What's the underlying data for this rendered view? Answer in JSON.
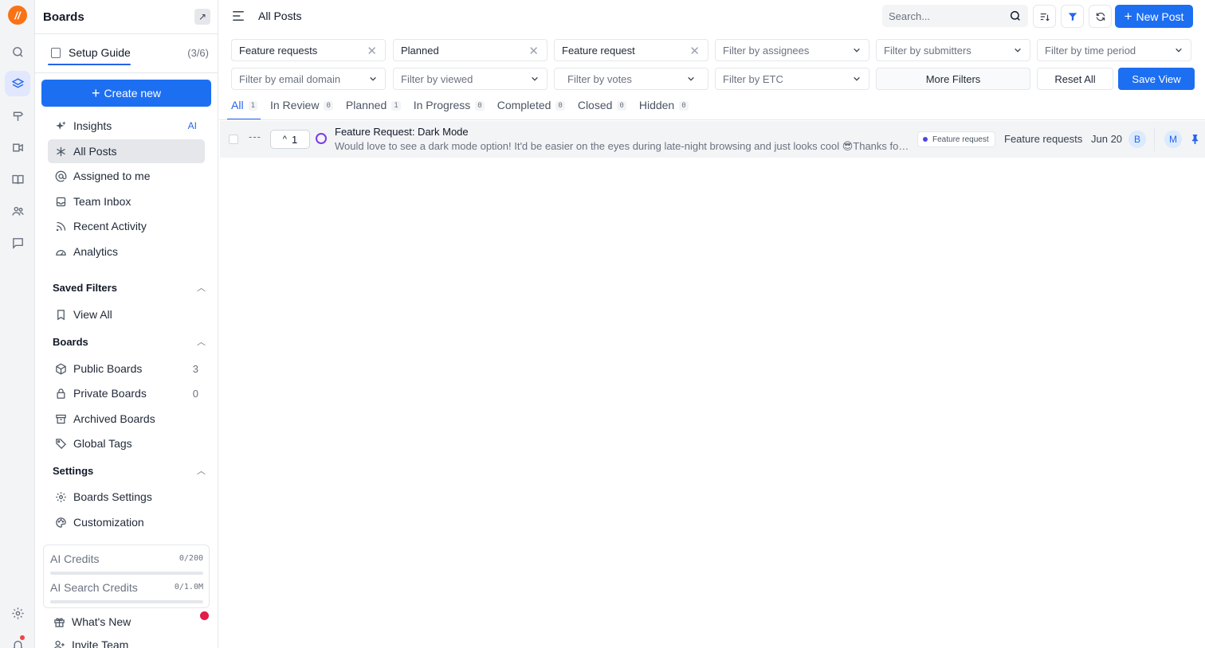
{
  "rail": {
    "logo": "//",
    "icons": [
      "search-icon",
      "layers-icon",
      "roadmap-icon",
      "changelog-icon",
      "book-icon",
      "users-icon",
      "chat-icon",
      "gear-icon",
      "bell-icon"
    ]
  },
  "sidebar": {
    "title": "Boards",
    "setup_label": "Setup Guide",
    "setup_count": "(3/6)",
    "create_label": "Create new",
    "nav": [
      {
        "label": "Insights",
        "badge": "AI"
      },
      {
        "label": "All Posts"
      },
      {
        "label": "Assigned to me"
      },
      {
        "label": "Team Inbox"
      },
      {
        "label": "Recent Activity"
      },
      {
        "label": "Analytics"
      }
    ],
    "saved_filters": {
      "title": "Saved Filters",
      "items": [
        {
          "label": "View All"
        }
      ]
    },
    "boards": {
      "title": "Boards",
      "items": [
        {
          "label": "Public Boards",
          "count": "3"
        },
        {
          "label": "Private Boards",
          "count": "0"
        },
        {
          "label": "Archived Boards"
        },
        {
          "label": "Global Tags"
        }
      ]
    },
    "settings": {
      "title": "Settings",
      "items": [
        {
          "label": "Boards Settings"
        },
        {
          "label": "Customization"
        }
      ]
    },
    "credits": [
      {
        "label": "AI Credits",
        "value": "0/200",
        "fill": 0
      },
      {
        "label": "AI Search Credits",
        "value": "0/1.0M",
        "fill": 0
      }
    ],
    "footer": [
      {
        "label": "What's New"
      },
      {
        "label": "Invite Team"
      }
    ]
  },
  "topbar": {
    "title": "All Posts",
    "search_placeholder": "Search...",
    "new_post_label": "New Post"
  },
  "filters": {
    "row1": [
      {
        "text": "Feature requests",
        "clearable": true
      },
      {
        "text": "Planned",
        "clearable": true
      },
      {
        "text": "Feature request",
        "clearable": true
      },
      {
        "text": "Filter by assignees"
      },
      {
        "text": "Filter by submitters"
      },
      {
        "text": "Filter by time period"
      }
    ],
    "row2": [
      {
        "text": "Filter by email domain"
      },
      {
        "text": "Filter by viewed"
      },
      {
        "text": "Filter by votes"
      },
      {
        "text": "Filter by ETC"
      }
    ],
    "more_label": "More Filters",
    "reset_label": "Reset All",
    "save_label": "Save View"
  },
  "tabs": [
    {
      "label": "All",
      "count": "1"
    },
    {
      "label": "In Review",
      "count": "0"
    },
    {
      "label": "Planned",
      "count": "1"
    },
    {
      "label": "In Progress",
      "count": "0"
    },
    {
      "label": "Completed",
      "count": "0"
    },
    {
      "label": "Closed",
      "count": "0"
    },
    {
      "label": "Hidden",
      "count": "0"
    }
  ],
  "posts": [
    {
      "votes": "1",
      "title": "Feature Request: Dark Mode",
      "description": "Would love to see a dark mode option! It'd be easier on the eyes during late-night browsing and just looks cool 😎Thanks for considering!",
      "tag": "Feature request",
      "board": "Feature requests",
      "date": "Jun 20",
      "avatar1": "B",
      "avatar2": "M"
    }
  ],
  "colors": {
    "accent": "#1d6ff2",
    "status_planned": "#7c3aed",
    "notification": "#e11d48"
  }
}
